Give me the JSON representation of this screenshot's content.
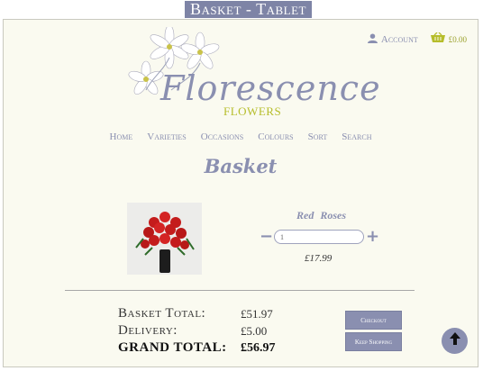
{
  "page_label": "Basket - Tablet",
  "topbar": {
    "account_label": "Account",
    "basket_amount": "£0.00"
  },
  "logo": {
    "title": "Florescence",
    "subtitle": "FLOWERS"
  },
  "nav": {
    "items": [
      "Home",
      "Varieties",
      "Occasions",
      "Colours",
      "Sort",
      "Search"
    ]
  },
  "page_title": "Basket",
  "product": {
    "name": "Red Roses",
    "quantity": "1",
    "price": "£17.99"
  },
  "totals": {
    "basket_total_label": "Basket Total:",
    "basket_total_value": "£51.97",
    "delivery_label": "Delivery:",
    "delivery_value": "£5.00",
    "grand_total_label": "GRAND TOTAL:",
    "grand_total_value": "£56.97"
  },
  "buttons": {
    "checkout": "Checkout",
    "keep_shopping": "Keep Shopping"
  },
  "colors": {
    "accent": "#8a8fb0",
    "brand_yellow": "#b6bd2a",
    "background": "#fafaf0"
  }
}
